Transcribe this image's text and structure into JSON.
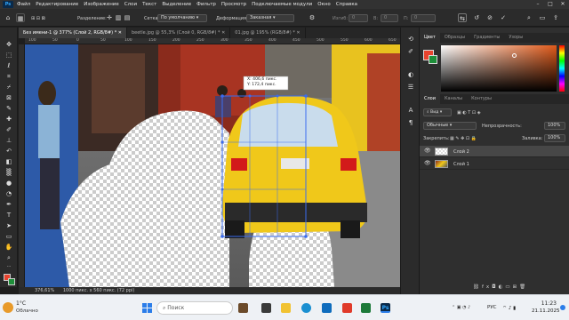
{
  "menu": {
    "app_logo": "Ps",
    "items": [
      "Файл",
      "Редактирование",
      "Изображение",
      "Слои",
      "Текст",
      "Выделение",
      "Фильтр",
      "Просмотр",
      "Подключаемые модули",
      "Окно",
      "Справка"
    ]
  },
  "window_controls": [
    "minimize-icon",
    "maximize-icon",
    "close-icon"
  ],
  "options": {
    "interpolation_label": "Разделение:",
    "grid_label": "Сетка:",
    "grid_value": "По умолчанию",
    "deform_label": "Деформация:",
    "deform_value": "Заказная",
    "h_label": "Изгиб:",
    "h_value": "0",
    "v_label": "В:",
    "v_value": "0",
    "p_label": "П:",
    "p_value": "0"
  },
  "tabs": [
    {
      "label": "Без имени-1 @ 377% (Слой 2, RGB/8#) *",
      "active": true
    },
    {
      "label": "beetle.jpg @ 55,3% (Слой 0, RGB/8#) *",
      "active": false
    },
    {
      "label": "01.jpg @ 195% (RGB/8#) *",
      "active": false
    }
  ],
  "ruler_ticks": [
    "100",
    "50",
    "0",
    "50",
    "100",
    "150",
    "200",
    "250",
    "300",
    "350",
    "400",
    "450",
    "500",
    "550",
    "600",
    "650"
  ],
  "canvas": {
    "transform_tooltip_x": "X: 406,6 пикс.",
    "transform_tooltip_y": "Y: 172,4 пикс."
  },
  "status": {
    "zoom": "376,61%",
    "doc_size": "1000 пикс. x 560 пикс. (72 ppi)"
  },
  "colors": {
    "foreground": "#e8442f",
    "background": "#1e8f3a",
    "hue_base": "#e05a1a"
  },
  "color_panel": {
    "tabs": [
      {
        "label": "Цвет",
        "active": true
      },
      {
        "label": "Образцы",
        "active": false
      },
      {
        "label": "Градиенты",
        "active": false
      },
      {
        "label": "Узоры",
        "active": false
      }
    ]
  },
  "layers_panel": {
    "tabs": [
      {
        "label": "Слои",
        "active": true
      },
      {
        "label": "Каналы",
        "active": false
      },
      {
        "label": "Контуры",
        "active": false
      }
    ],
    "search_placeholder": "Вид",
    "blend_mode": "Обычные",
    "opacity_label": "Непрозрачность:",
    "opacity_value": "100%",
    "lock_label": "Закрепить:",
    "fill_label": "Заливка:",
    "fill_value": "100%",
    "layers": [
      {
        "name": "Слой 2",
        "selected": true
      },
      {
        "name": "Слой 1",
        "selected": false
      }
    ],
    "footer_icons": [
      "link-icon",
      "fx-icon",
      "mask-icon",
      "adjustment-icon",
      "folder-icon",
      "new-layer-icon",
      "trash-icon"
    ]
  },
  "taskbar": {
    "weather_temp": "1°С",
    "weather_desc": "Облачно",
    "search_placeholder": "Поиск",
    "tray_lang": "РУС",
    "time": "11:23",
    "date": "21.11.2025"
  }
}
